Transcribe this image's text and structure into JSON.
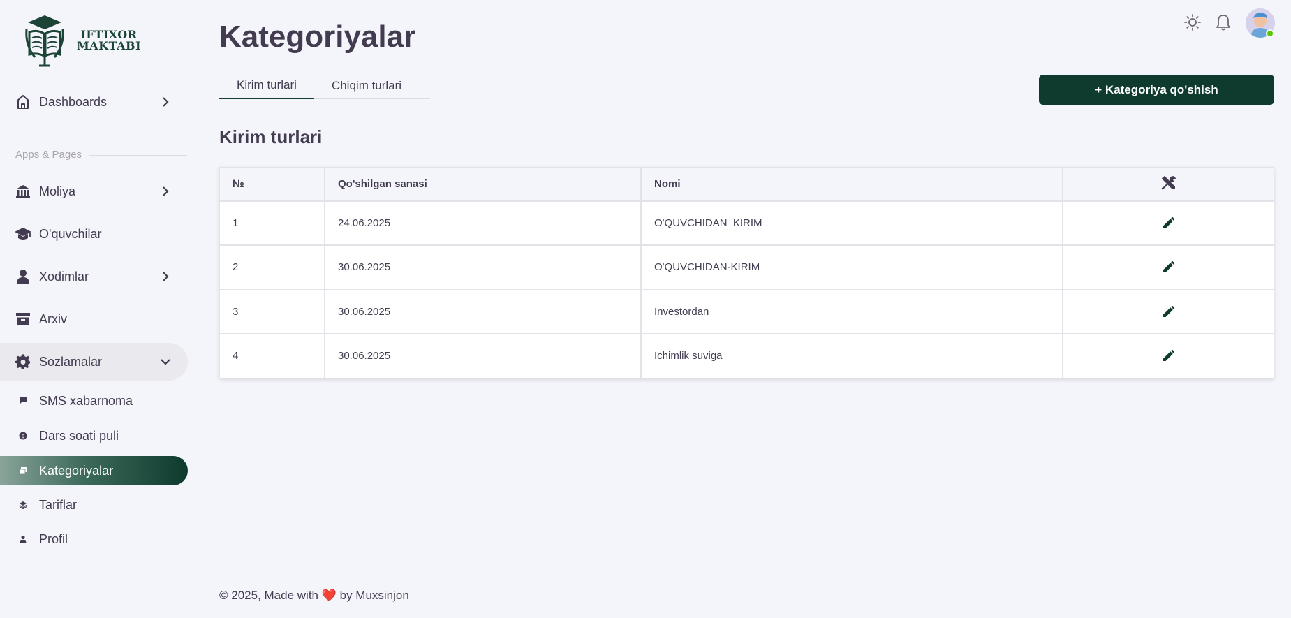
{
  "brand": {
    "line1": "IFTIXOR",
    "line2": "MAKTABI"
  },
  "sidebar": {
    "dashboards": "Dashboards",
    "section_label": "Apps & Pages",
    "items": [
      {
        "label": "Moliya"
      },
      {
        "label": "O'quvchilar"
      },
      {
        "label": "Xodimlar"
      },
      {
        "label": "Arxiv"
      },
      {
        "label": "Sozlamalar"
      }
    ],
    "subitems": [
      {
        "label": "SMS xabarnoma"
      },
      {
        "label": "Dars soati puli"
      },
      {
        "label": "Kategoriyalar"
      },
      {
        "label": "Tariflar"
      },
      {
        "label": "Profil"
      }
    ]
  },
  "header": {
    "title": "Kategoriyalar",
    "tabs": [
      {
        "label": "Kirim turlari"
      },
      {
        "label": "Chiqim turlari"
      }
    ],
    "add_button": "+ Kategoriya qo'shish"
  },
  "section": {
    "title": "Kirim turlari"
  },
  "table": {
    "columns": [
      "№",
      "Qo'shilgan sanasi",
      "Nomi"
    ],
    "actions_icon": "wrench-screwdriver-icon",
    "rows": [
      {
        "num": "1",
        "date": "24.06.2025",
        "name": "O'QUVCHIDAN_KIRIM"
      },
      {
        "num": "2",
        "date": "30.06.2025",
        "name": "O'QUVCHIDAN-KIRIM"
      },
      {
        "num": "3",
        "date": "30.06.2025",
        "name": "Investordan"
      },
      {
        "num": "4",
        "date": "30.06.2025",
        "name": "Ichimlik suviga"
      }
    ]
  },
  "footer": {
    "prefix": "© 2025, Made with ",
    "heart": "❤️",
    "suffix": " by Muxsinjon"
  },
  "colors": {
    "accent": "#0e3b2e",
    "background": "#f4f5fa",
    "text": "#433c50",
    "online": "#56ca00"
  }
}
